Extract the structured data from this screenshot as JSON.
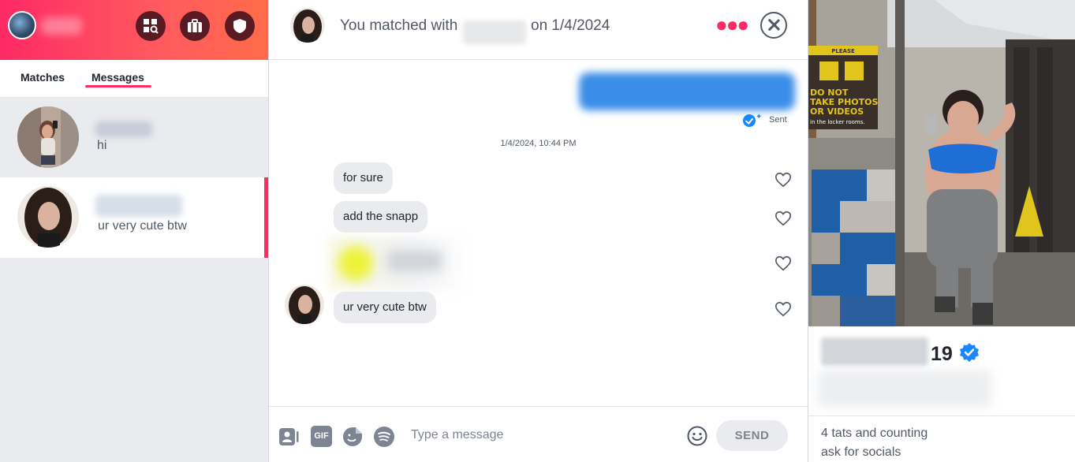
{
  "header_icons": [
    "explore-icon",
    "briefcase-icon",
    "shield-icon"
  ],
  "tabs": {
    "matches": "Matches",
    "messages": "Messages"
  },
  "conversations": [
    {
      "preview": "hi",
      "active": false
    },
    {
      "preview": "ur very cute btw",
      "active": true
    }
  ],
  "chat": {
    "match_prefix": "You matched with",
    "match_date": "on 1/4/2024",
    "sent_status": "Sent",
    "timestamp": "1/4/2024, 10:44 PM",
    "messages": [
      {
        "text": "for sure"
      },
      {
        "text": "add the snapp"
      },
      {
        "text": "ur very cute btw"
      }
    ],
    "composer": {
      "placeholder": "Type a message",
      "gif_label": "GIF",
      "send_label": "SEND"
    }
  },
  "profile": {
    "age": "19",
    "verified": true,
    "bio": [
      "4 tats and counting",
      "ask for socials"
    ],
    "photo_sign": {
      "top": "PLEASE",
      "line1": "DO NOT",
      "line2": "TAKE PHOTOS",
      "line3": "OR VIDEOS",
      "line4": "in the locker rooms."
    }
  },
  "colors": {
    "brand_gradient_start": "#fd2a64",
    "brand_gradient_end": "#ff6b4a",
    "accent": "#fd2a64",
    "verified_blue": "#1786ff",
    "bubble_gray": "#e9ebee"
  }
}
